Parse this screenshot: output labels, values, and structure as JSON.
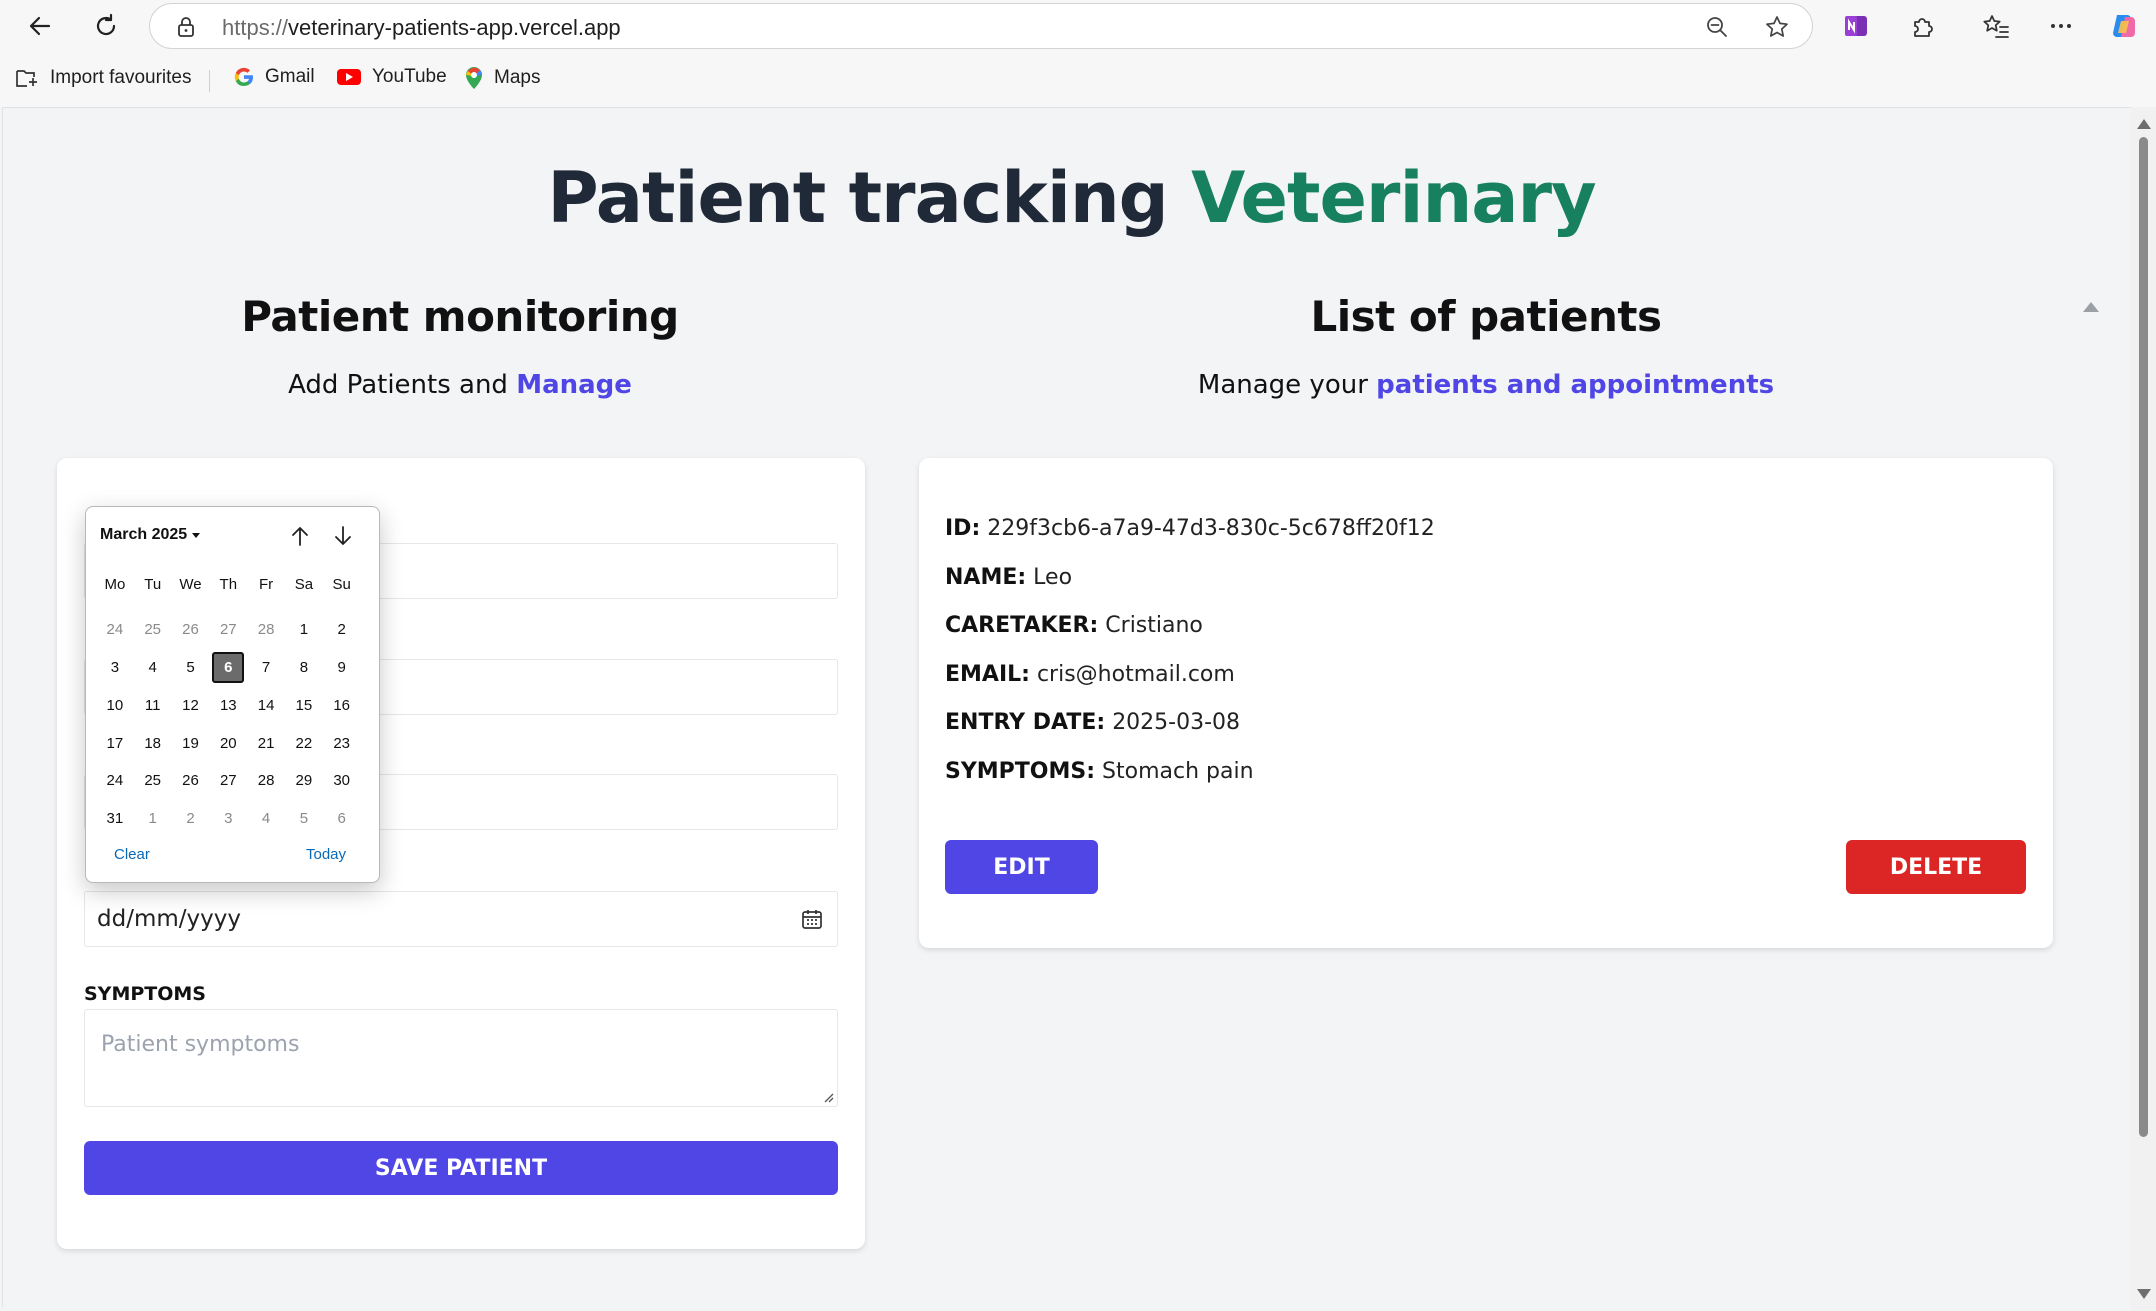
{
  "browser": {
    "url_proto": "https://",
    "url_host": "veterinary-patients-app.vercel.app",
    "bookmarks": [
      {
        "label": "Import favourites"
      },
      {
        "label": "Gmail"
      },
      {
        "label": "YouTube"
      },
      {
        "label": "Maps"
      }
    ]
  },
  "page": {
    "title_main": "Patient tracking ",
    "title_accent": "Veterinary",
    "left": {
      "title": "Patient monitoring",
      "subtitle_plain": "Add Patients and ",
      "subtitle_link": "Manage"
    },
    "right": {
      "title": "List of patients",
      "subtitle_plain": "Manage your ",
      "subtitle_link": "patients and appointments"
    }
  },
  "form": {
    "date_placeholder": "dd/mm/yyyy",
    "symptoms_label": "SYMPTOMS",
    "symptoms_placeholder": "Patient symptoms",
    "save_label": "SAVE PATIENT"
  },
  "datepicker": {
    "month_label": "March 2025",
    "weekdays": [
      "Mo",
      "Tu",
      "We",
      "Th",
      "Fr",
      "Sa",
      "Su"
    ],
    "days": [
      [
        "24",
        "25",
        "26",
        "27",
        "28",
        "1",
        "2"
      ],
      [
        "3",
        "4",
        "5",
        "6",
        "7",
        "8",
        "9"
      ],
      [
        "10",
        "11",
        "12",
        "13",
        "14",
        "15",
        "16"
      ],
      [
        "17",
        "18",
        "19",
        "20",
        "21",
        "22",
        "23"
      ],
      [
        "24",
        "25",
        "26",
        "27",
        "28",
        "29",
        "30"
      ],
      [
        "31",
        "1",
        "2",
        "3",
        "4",
        "5",
        "6"
      ]
    ],
    "selected_day": "6",
    "clear_label": "Clear",
    "today_label": "Today"
  },
  "patient": {
    "id_label": "ID:",
    "id": "229f3cb6-a7a9-47d3-830c-5c678ff20f12",
    "name_label": "NAME:",
    "name": "Leo",
    "caretaker_label": "CARETAKER:",
    "caretaker": "Cristiano",
    "email_label": "EMAIL:",
    "email": "cris@hotmail.com",
    "entry_label": "ENTRY DATE:",
    "entry_date": "2025-03-08",
    "symptoms_label": "SYMPTOMS:",
    "symptoms": "Stomach pain",
    "edit_label": "EDIT",
    "delete_label": "DELETE"
  },
  "colors": {
    "accent_green": "#16805f",
    "link_indigo": "#4f46e5",
    "primary_button": "#4f46e5",
    "danger_button": "#dc2626"
  }
}
